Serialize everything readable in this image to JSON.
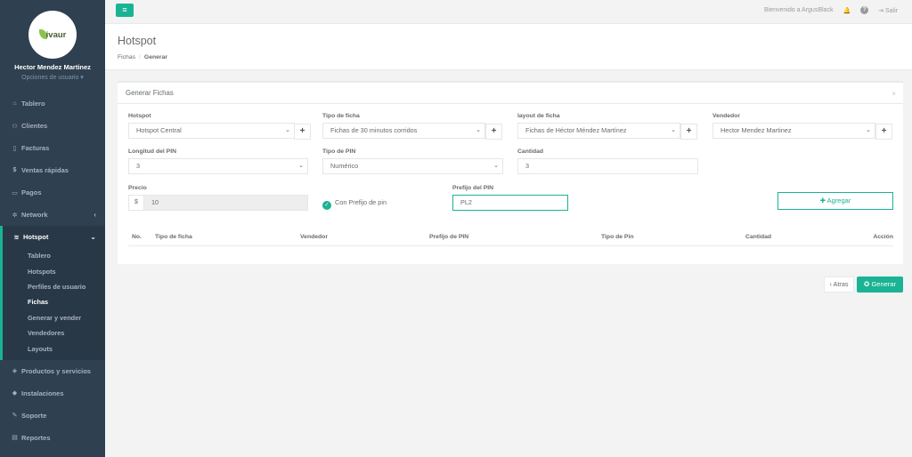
{
  "brand": {
    "logo_text": "ivaur",
    "leaf_color": "#8bc34a"
  },
  "user": {
    "name": "Hector Mendez Martinez",
    "options": "Opciones de usuario ▾"
  },
  "sidebar": {
    "items_top": [
      {
        "label": "Tablero",
        "icon": "dashboard-icon",
        "glyph": "⌂"
      },
      {
        "label": "Clientes",
        "icon": "users-icon",
        "glyph": "👥"
      },
      {
        "label": "Facturas",
        "icon": "document-icon",
        "glyph": "▯"
      },
      {
        "label": "Ventas rápidas",
        "icon": "dollar-icon",
        "glyph": "$"
      },
      {
        "label": "Pagos",
        "icon": "money-icon",
        "glyph": "▭"
      },
      {
        "label": "Network",
        "icon": "network-icon",
        "glyph": "✲",
        "chevron": "‹"
      }
    ],
    "active": {
      "label": "Hotspot",
      "icon": "wifi-icon",
      "glyph": "≋",
      "chevron": "⌄"
    },
    "sub_items": [
      "Tablero",
      "Hotspots",
      "Perfiles de usuario",
      "Fichas",
      "Generar y vender",
      "Vendedores",
      "Layouts"
    ],
    "current_sub": "Fichas",
    "items_bottom": [
      {
        "label": "Productos y servicios",
        "icon": "tag-icon",
        "glyph": "◈"
      },
      {
        "label": "Instalaciones",
        "icon": "diamond-icon",
        "glyph": "◆"
      },
      {
        "label": "Soporte",
        "icon": "wrench-icon",
        "glyph": "✎"
      },
      {
        "label": "Reportes",
        "icon": "book-icon",
        "glyph": "▤"
      }
    ]
  },
  "topbar": {
    "menu_glyph": "≡",
    "welcome": "Bienvenido a ArgusBlack",
    "logout": "Salir"
  },
  "page": {
    "title": "Hotspot",
    "breadcrumb": [
      "Fichas",
      "Generar"
    ]
  },
  "panel": {
    "title": "Generar Fichas",
    "close": "×",
    "fields": {
      "hotspot": {
        "label": "Hotspot",
        "value": "Hotspot Central"
      },
      "tipo_ficha": {
        "label": "Tipo de ficha",
        "value": "Fichas de 30 minutos corridos"
      },
      "layout": {
        "label": "layout de ficha",
        "value": "Fichas de Héctor Méndez Martínez"
      },
      "vendedor": {
        "label": "Vendedor",
        "value": "Hector Mendez Martinez"
      },
      "longitud_pin": {
        "label": "Longitud del PIN",
        "value": "3"
      },
      "tipo_pin": {
        "label": "Tipo de PIN",
        "value": "Numérico"
      },
      "cantidad": {
        "label": "Cantidad",
        "value": "3"
      },
      "precio": {
        "label": "Precio",
        "addon": "$",
        "value": "10"
      },
      "con_prefijo": {
        "label": "Con Prefijo de pin",
        "checked": true
      },
      "prefijo": {
        "label": "Prefijo del PIN",
        "value": "PL2"
      }
    },
    "add_button": "Agregar",
    "table_headers": [
      "No.",
      "Tipo de ficha",
      "Vendedor",
      "Prefijo de PIN",
      "Tipo de Pin",
      "Cantidad",
      "Acción"
    ]
  },
  "footer_buttons": {
    "back": "‹ Atras",
    "generate": "Generar"
  },
  "colors": {
    "accent": "#1ab394",
    "sidebar_bg": "#2f4050"
  }
}
